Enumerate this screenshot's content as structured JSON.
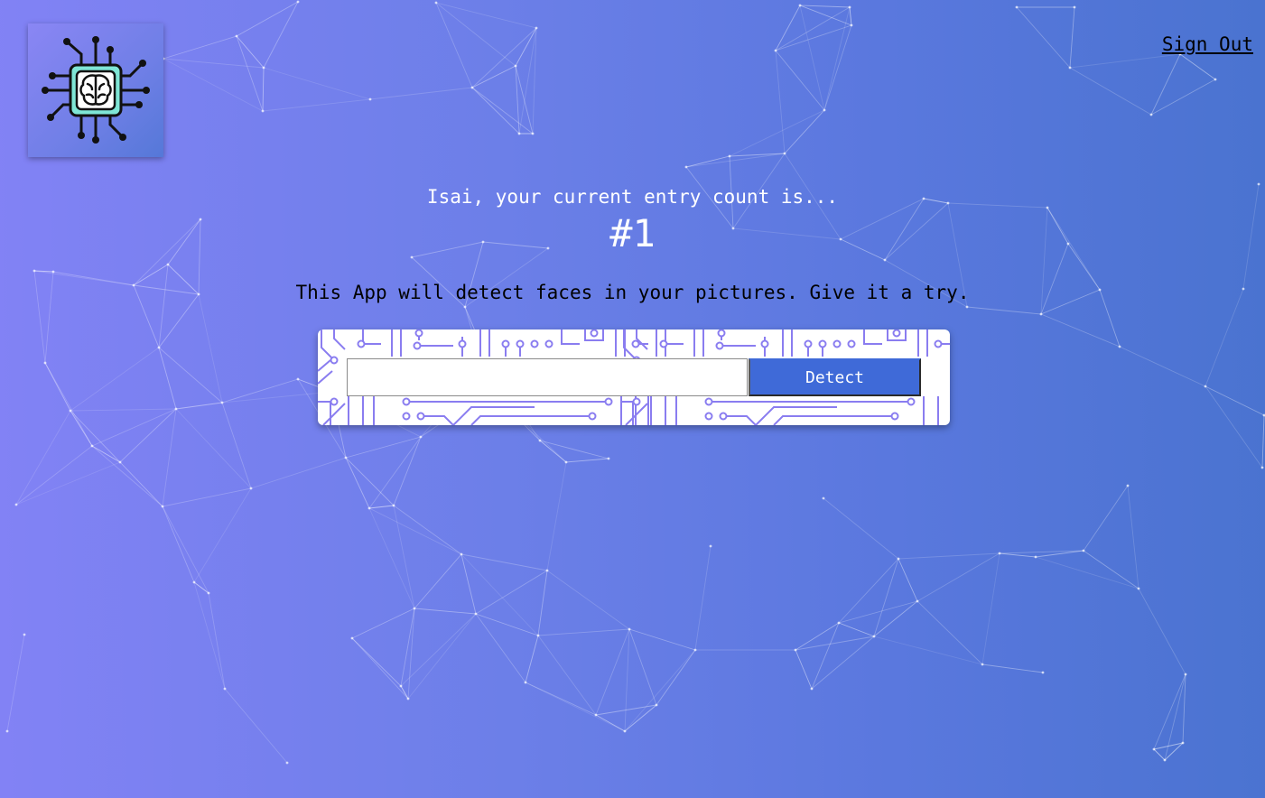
{
  "header": {
    "logo_icon": "brain-chip-icon",
    "signout_label": "Sign Out"
  },
  "rank": {
    "message": "Isai, your current entry count is...",
    "count": "#1"
  },
  "intro": {
    "text": "This App will detect faces in your pictures. Give it a try."
  },
  "form": {
    "input_value": "",
    "input_placeholder": "",
    "button_label": "Detect",
    "pattern_icon": "circuit-pattern"
  },
  "colors": {
    "background_start": "#8282f5",
    "background_end": "#4a73d0",
    "button": "#3f6ad8",
    "circuit": "#8a7df0",
    "logo_chip": "#7fe6d6"
  }
}
